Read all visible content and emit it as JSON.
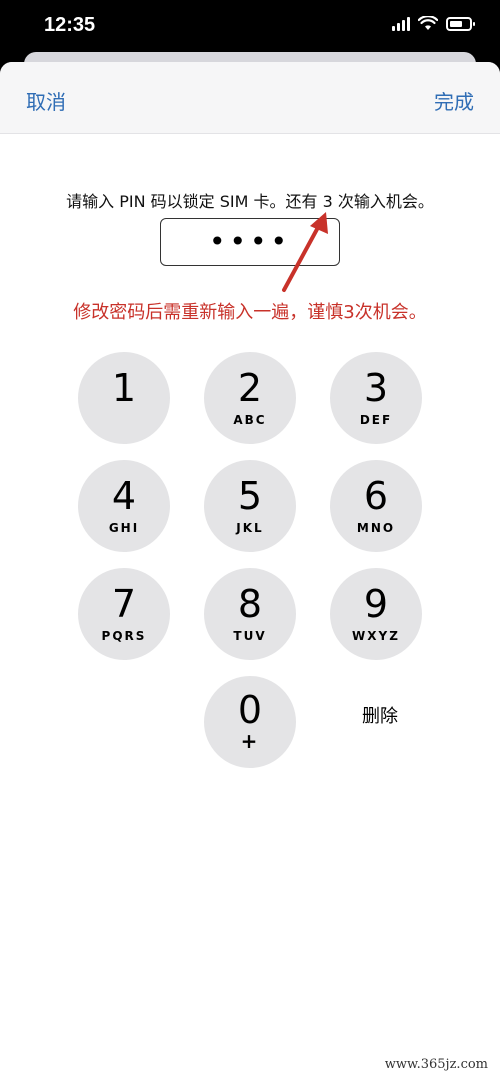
{
  "status_bar": {
    "time": "12:35"
  },
  "nav": {
    "cancel_label": "取消",
    "done_label": "完成"
  },
  "prompt": "请输入 PIN 码以锁定 SIM 卡。还有 3 次输入机会。",
  "pin_field": {
    "masked_value": "••••"
  },
  "annotation": "修改密码后需重新输入一遍，谨慎3次机会。",
  "keypad": {
    "keys": [
      {
        "digit": "1",
        "letters": ""
      },
      {
        "digit": "2",
        "letters": "ABC"
      },
      {
        "digit": "3",
        "letters": "DEF"
      },
      {
        "digit": "4",
        "letters": "GHI"
      },
      {
        "digit": "5",
        "letters": "JKL"
      },
      {
        "digit": "6",
        "letters": "MNO"
      },
      {
        "digit": "7",
        "letters": "PQRS"
      },
      {
        "digit": "8",
        "letters": "TUV"
      },
      {
        "digit": "9",
        "letters": "WXYZ"
      },
      {
        "digit": "0",
        "letters": "+"
      }
    ],
    "delete_label": "删除"
  },
  "watermark": "www.365jz.com",
  "colors": {
    "accent": "#2f6db5",
    "annotation": "#c8322a",
    "key_bg": "#e4e4e6"
  }
}
